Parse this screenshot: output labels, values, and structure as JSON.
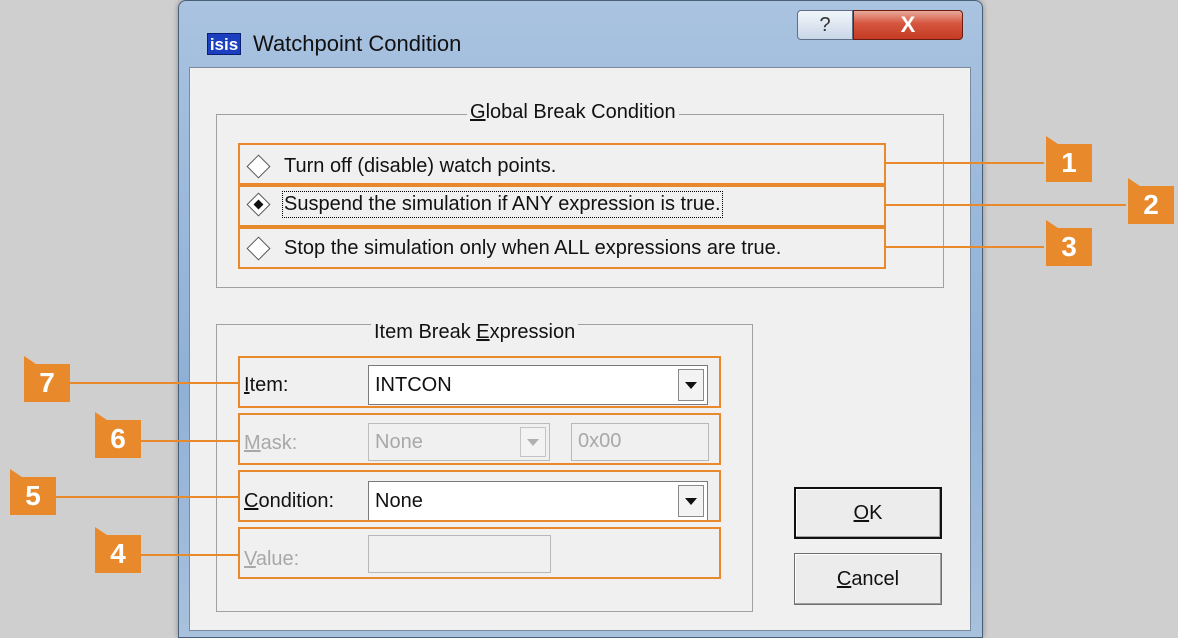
{
  "window": {
    "app_icon_text": "isis",
    "title": "Watchpoint Condition",
    "help_symbol": "?",
    "close_symbol": "X"
  },
  "global_break": {
    "legend_pre": "",
    "legend_ul": "G",
    "legend_post": "lobal Break Condition",
    "options": [
      {
        "label": "Turn off (disable) watch points.",
        "selected": false
      },
      {
        "label": "Suspend the simulation if ANY expression is true.",
        "selected": true
      },
      {
        "label": "Stop the simulation only when ALL expressions are true.",
        "selected": false
      }
    ]
  },
  "item_break": {
    "legend_pre": "Item Break ",
    "legend_ul": "E",
    "legend_post": "xpression",
    "item": {
      "label_ul": "I",
      "label_rest": "tem:",
      "value": "INTCON"
    },
    "mask": {
      "label_ul": "M",
      "label_rest": "ask:",
      "value": "None",
      "hex": "0x00"
    },
    "condition": {
      "label_ul": "C",
      "label_rest": "ondition:",
      "value": "None"
    },
    "value": {
      "label_ul": "V",
      "label_rest": "alue:",
      "value": ""
    }
  },
  "buttons": {
    "ok_ul": "O",
    "ok_rest": "K",
    "cancel_ul": "C",
    "cancel_rest": "ancel"
  },
  "callouts": {
    "accent_color": "#e8892b",
    "numbers": [
      "1",
      "2",
      "3",
      "4",
      "5",
      "6",
      "7"
    ]
  }
}
